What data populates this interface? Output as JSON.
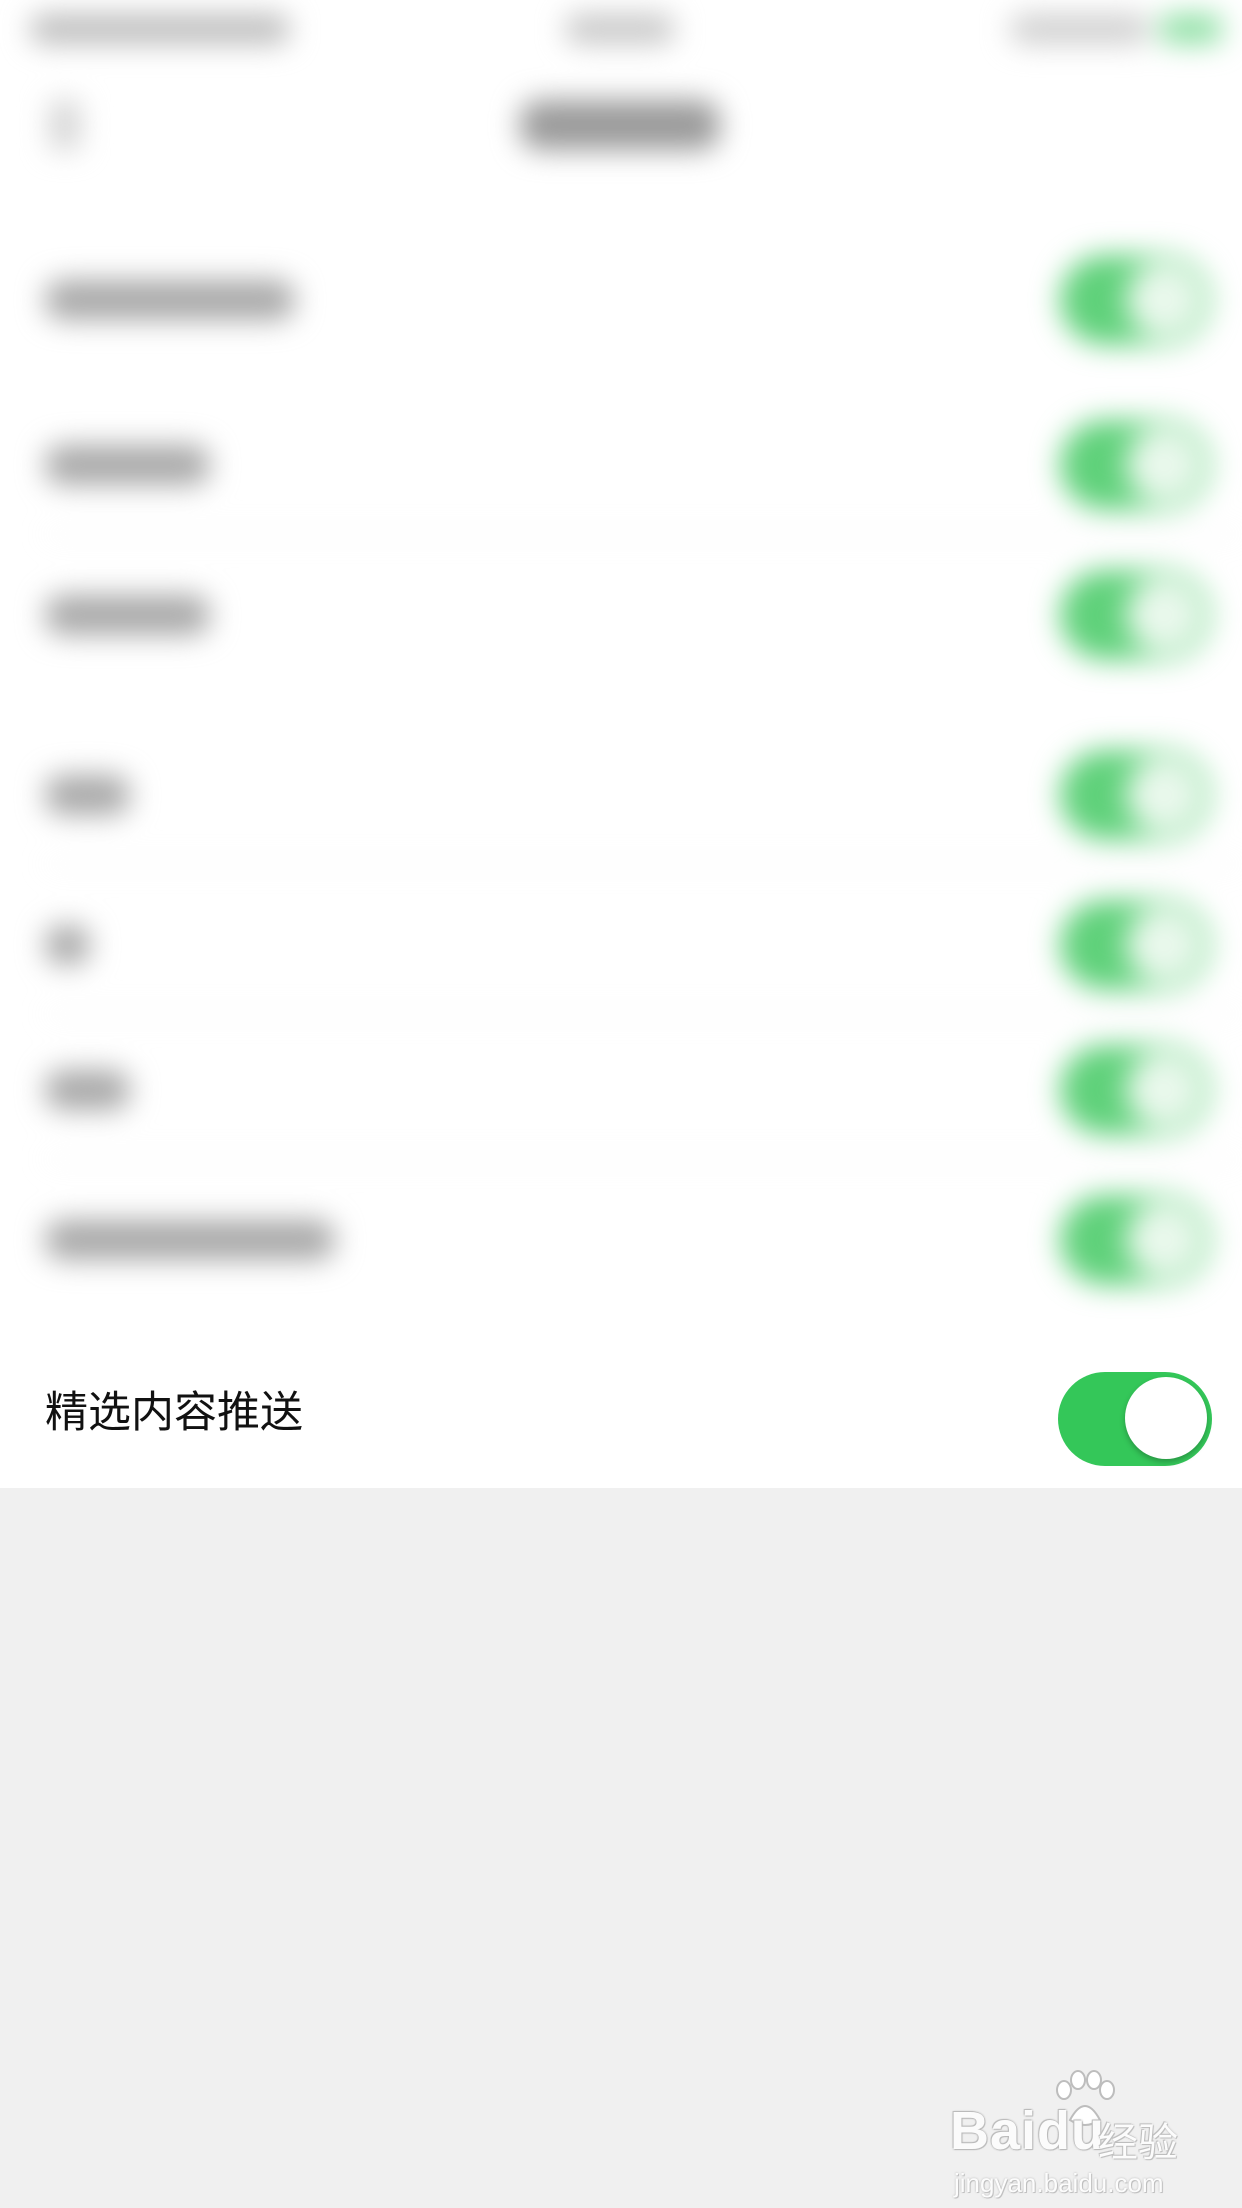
{
  "settings": {
    "featured_push": {
      "label": "精选内容推送",
      "enabled": true
    }
  },
  "colors": {
    "toggle_on": "#34c759",
    "row_background": "#ffffff",
    "page_background": "#f0f0f0"
  },
  "watermark": {
    "brand": "Baidu",
    "suffix": "经验",
    "url": "jingyan.baidu.com"
  }
}
